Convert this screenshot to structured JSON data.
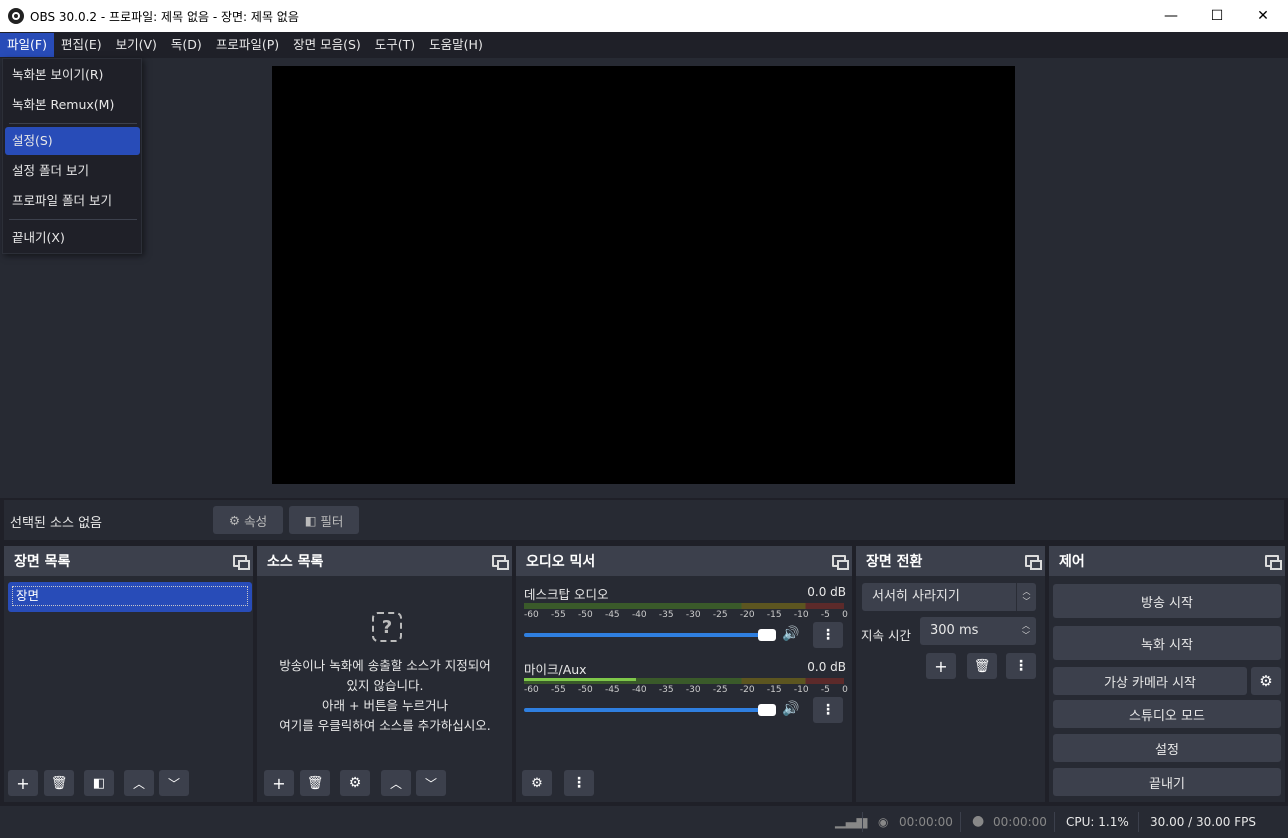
{
  "window": {
    "title": "OBS 30.0.2 - 프로파일: 제목 없음 - 장면: 제목 없음",
    "minimize": "—",
    "maximize": "☐",
    "close": "✕"
  },
  "menu": {
    "file": "파일(F)",
    "edit": "편집(E)",
    "view": "보기(V)",
    "dock": "독(D)",
    "profile": "프로파일(P)",
    "scene_collection": "장면 모음(S)",
    "tools": "도구(T)",
    "help": "도움말(H)"
  },
  "file_menu": {
    "show_recordings": "녹화본 보이기(R)",
    "remux": "녹화본 Remux(M)",
    "settings": "설정(S)",
    "settings_folder": "설정 폴더 보기",
    "profile_folder": "프로파일 폴더 보기",
    "exit": "끝내기(X)"
  },
  "source_bar": {
    "no_source": "선택된 소스 없음",
    "properties": "속성",
    "filters": "필터"
  },
  "scenes": {
    "title": "장면 목록",
    "items": [
      "장면"
    ]
  },
  "sources": {
    "title": "소스 목록",
    "empty_line1": "방송이나 녹화에 송출할 소스가 지정되어",
    "empty_line2": "있지 않습니다.",
    "empty_line3": "아래 + 버튼을 누르거나",
    "empty_line4": "여기를 우클릭하여 소스를 추가하십시오."
  },
  "mixer": {
    "title": "오디오 믹서",
    "channels": [
      {
        "name": "데스크탑 오디오",
        "db": "0.0 dB",
        "level": 0
      },
      {
        "name": "마이크/Aux",
        "db": "0.0 dB",
        "level": 0.35
      }
    ],
    "scale": [
      "-60",
      "-55",
      "-50",
      "-45",
      "-40",
      "-35",
      "-30",
      "-25",
      "-20",
      "-15",
      "-10",
      "-5",
      "0"
    ]
  },
  "transitions": {
    "title": "장면 전환",
    "type": "서서히 사라지기",
    "duration_label": "지속 시간",
    "duration": "300 ms"
  },
  "controls": {
    "title": "제어",
    "start_stream": "방송 시작",
    "start_record": "녹화 시작",
    "start_vcam": "가상 카메라 시작",
    "studio_mode": "스튜디오 모드",
    "settings": "설정",
    "exit": "끝내기"
  },
  "status": {
    "stream_time": "00:00:00",
    "record_time": "00:00:00",
    "cpu": "CPU: 1.1%",
    "fps": "30.00 / 30.00 FPS"
  },
  "colors": {
    "accent": "#284cb8",
    "dock_bg": "#272a33",
    "header_bg": "#3c404c"
  }
}
